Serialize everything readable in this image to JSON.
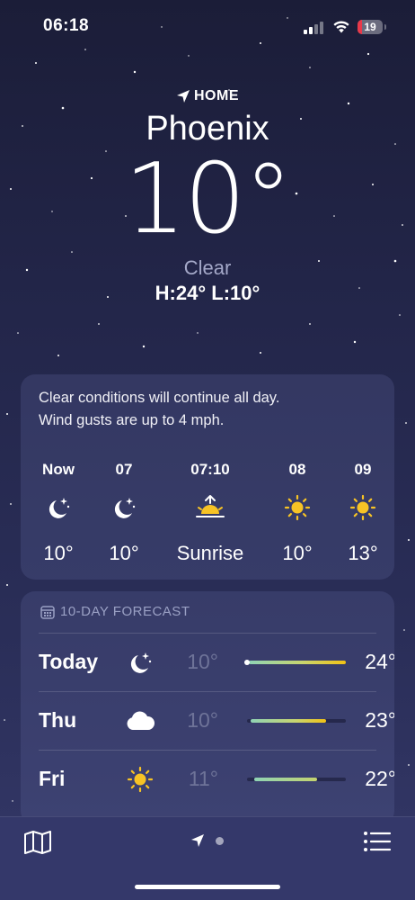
{
  "status_bar": {
    "time": "06:18",
    "battery_level": "19",
    "battery_color": "#e9394a",
    "icons": [
      "signal-icon",
      "wifi-icon",
      "battery-icon"
    ]
  },
  "header": {
    "location_label": "HOME",
    "location_icon": "location-arrow-icon",
    "city": "Phoenix",
    "temperature": "10°",
    "condition": "Clear",
    "high_low": "H:24°  L:10°"
  },
  "hourly": {
    "summary_line1": "Clear conditions will continue all day.",
    "summary_line2": "Wind gusts are up to 4 mph.",
    "hours": [
      {
        "label": "Now",
        "icon": "moon-stars-icon",
        "temp": "10°"
      },
      {
        "label": "07",
        "icon": "moon-stars-icon",
        "temp": "10°"
      },
      {
        "label": "07:10",
        "icon": "sunrise-icon",
        "temp": "Sunrise"
      },
      {
        "label": "08",
        "icon": "sun-icon",
        "temp": "10°"
      },
      {
        "label": "09",
        "icon": "sun-icon",
        "temp": "13°"
      }
    ]
  },
  "forecast": {
    "title": "10-DAY FORECAST",
    "title_icon": "calendar-icon",
    "days": [
      {
        "day": "Today",
        "icon": "moon-stars-icon",
        "low": "10°",
        "high": "24°"
      },
      {
        "day": "Thu",
        "icon": "cloud-icon",
        "low": "10°",
        "high": "23°"
      },
      {
        "day": "Fri",
        "icon": "sun-icon",
        "low": "11°",
        "high": "22°"
      }
    ]
  },
  "bottom_bar": {
    "icons": [
      "map-icon",
      "location-arrow-icon",
      "page-dot",
      "list-icon"
    ]
  },
  "colors": {
    "sun_yellow": "#f7c325",
    "range_gradient_start": "#8fd3b5",
    "range_gradient_end": "#f2c215",
    "muted_text": "#a4a8c8"
  }
}
